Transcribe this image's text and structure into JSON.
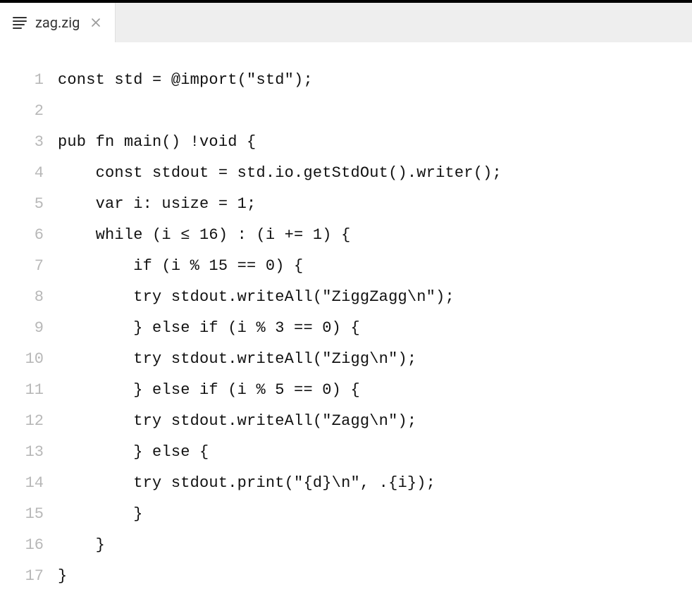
{
  "tab": {
    "filename": "zag.zig"
  },
  "code": {
    "lines": [
      {
        "n": "1",
        "text": "const std = @import(\"std\");"
      },
      {
        "n": "2",
        "text": ""
      },
      {
        "n": "3",
        "text": "pub fn main() !void {"
      },
      {
        "n": "4",
        "text": "    const stdout = std.io.getStdOut().writer();"
      },
      {
        "n": "5",
        "text": "    var i: usize = 1;"
      },
      {
        "n": "6",
        "text": "    while (i ≤ 16) : (i += 1) {"
      },
      {
        "n": "7",
        "text": "        if (i % 15 == 0) {"
      },
      {
        "n": "8",
        "text": "        try stdout.writeAll(\"ZiggZagg\\n\");"
      },
      {
        "n": "9",
        "text": "        } else if (i % 3 == 0) {"
      },
      {
        "n": "10",
        "text": "        try stdout.writeAll(\"Zigg\\n\");"
      },
      {
        "n": "11",
        "text": "        } else if (i % 5 == 0) {"
      },
      {
        "n": "12",
        "text": "        try stdout.writeAll(\"Zagg\\n\");"
      },
      {
        "n": "13",
        "text": "        } else {"
      },
      {
        "n": "14",
        "text": "        try stdout.print(\"{d}\\n\", .{i});"
      },
      {
        "n": "15",
        "text": "        }"
      },
      {
        "n": "16",
        "text": "    }"
      },
      {
        "n": "17",
        "text": "}"
      }
    ]
  }
}
